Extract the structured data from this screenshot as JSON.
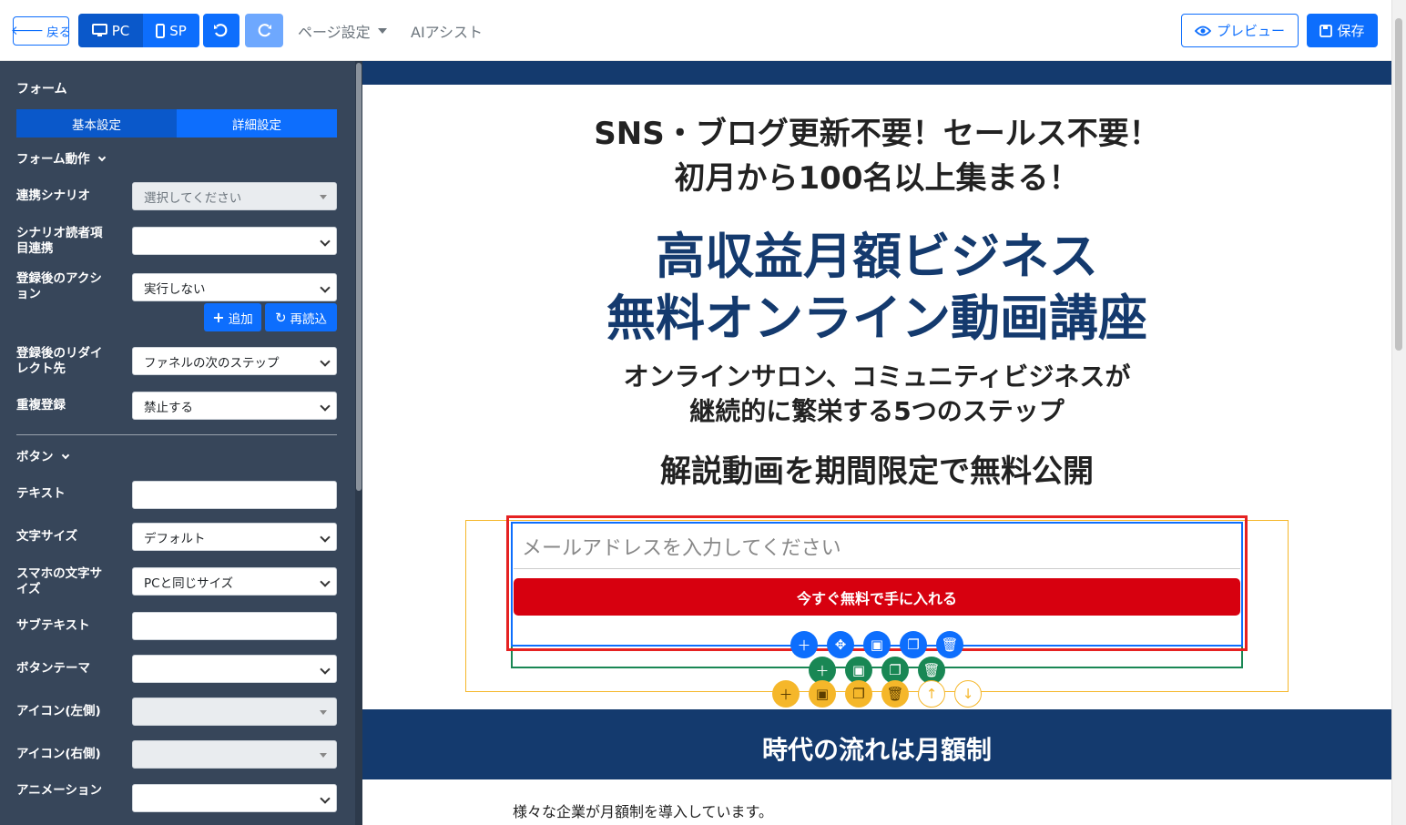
{
  "topbar": {
    "back_label": "戻る",
    "pc_label": "PC",
    "sp_label": "SP",
    "page_settings_label": "ページ設定",
    "ai_assist_label": "AIアシスト",
    "preview_label": "プレビュー",
    "save_label": "保存"
  },
  "sidebar": {
    "title": "フォーム",
    "tabs": [
      "基本設定",
      "詳細設定"
    ],
    "section_form_action": "フォーム動作",
    "scenario_label": "連携シナリオ",
    "scenario_placeholder": "選択してください",
    "reader_field_label": "シナリオ読者項目連携",
    "reader_field_value": "",
    "post_action_label": "登録後のアクション",
    "post_action_value": "実行しない",
    "add_label": "追加",
    "reload_label": "再読込",
    "redirect_label": "登録後のリダイレクト先",
    "redirect_value": "ファネルの次のステップ",
    "duplicate_label": "重複登録",
    "duplicate_value": "禁止する",
    "section_button": "ボタン",
    "text_label": "テキスト",
    "text_value": "",
    "font_size_label": "文字サイズ",
    "font_size_value": "デフォルト",
    "sp_font_size_label": "スマホの文字サイズ",
    "sp_font_size_value": "PCと同じサイズ",
    "subtext_label": "サブテキスト",
    "subtext_value": "",
    "theme_label": "ボタンテーマ",
    "theme_value": "",
    "icon_left_label": "アイコン(左側)",
    "icon_right_label": "アイコン(右側)",
    "animation_label": "アニメーション",
    "animation_value": ""
  },
  "page": {
    "headline1": "SNS・ブログ更新不要！セールス不要！",
    "headline2": "初月から100名以上集まる！",
    "title1": "高収益月額ビジネス",
    "title2": "無料オンライン動画講座",
    "sub1": "オンラインサロン、コミュニティビジネスが",
    "sub2": "継続的に繁栄する5つのステップ",
    "sub3": "解説動画を期間限定で無料公開",
    "email_placeholder": "メールアドレスを入力してください",
    "cta_label": "今すぐ無料で手に入れる",
    "section_heading": "時代の流れは月額制",
    "body_text": "様々な企業が月額制を導入しています。"
  },
  "colors": {
    "primary": "#0d6efd",
    "navy": "#143a6e",
    "sidebar_bg": "#37465a",
    "cta_red": "#d7000f",
    "select_frame": "#e52222",
    "green": "#198754",
    "amber": "#f5b72a"
  }
}
